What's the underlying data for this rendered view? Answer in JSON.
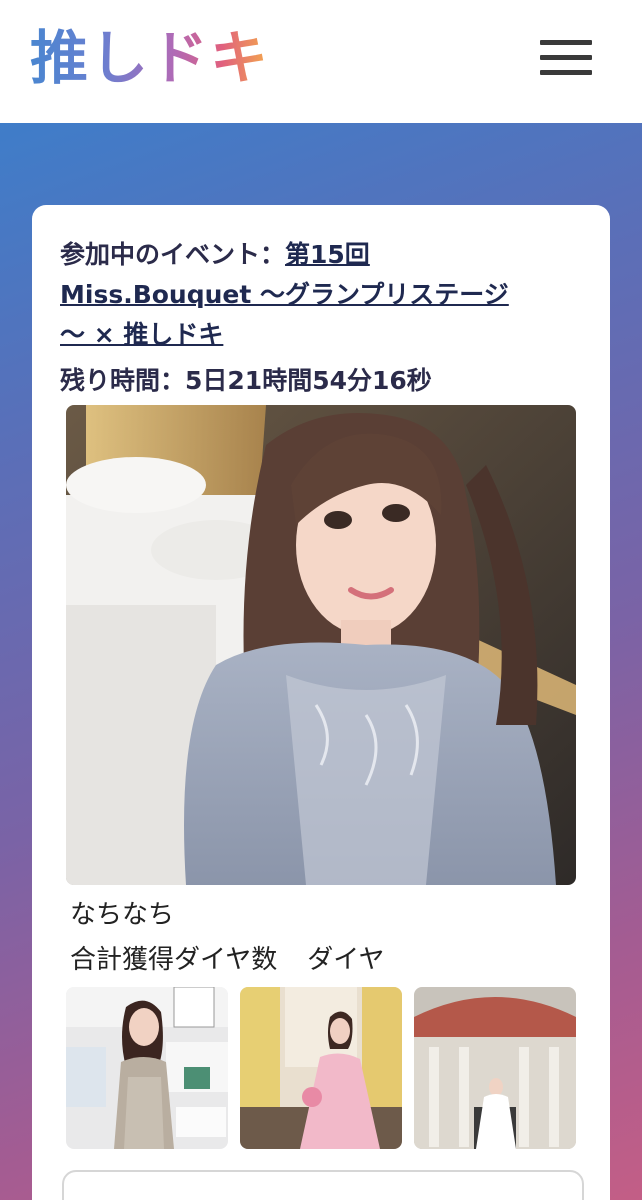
{
  "header": {
    "logo_text": "推しドキ",
    "menu_icon": "hamburger-menu-icon"
  },
  "event": {
    "prefix": "参加中のイベント：",
    "link_text": "第15回Miss.Bouquet 〜グランプリステージ〜 × 推しドキ",
    "link_line1": "第15回",
    "link_line2": "Miss.Bouquet 〜グランプリステージ",
    "link_line3": "〜 × 推しドキ"
  },
  "remaining": {
    "label": "残り時間：",
    "value": "5日21時間54分16秒"
  },
  "profile": {
    "name": "なちなち",
    "total_label": "合計獲得ダイヤ数",
    "total_unit": "ダイヤ"
  },
  "colors": {
    "bg_gradient_start": "#3f7dc9",
    "bg_gradient_end": "#c35e86",
    "link": "#1f2950"
  }
}
